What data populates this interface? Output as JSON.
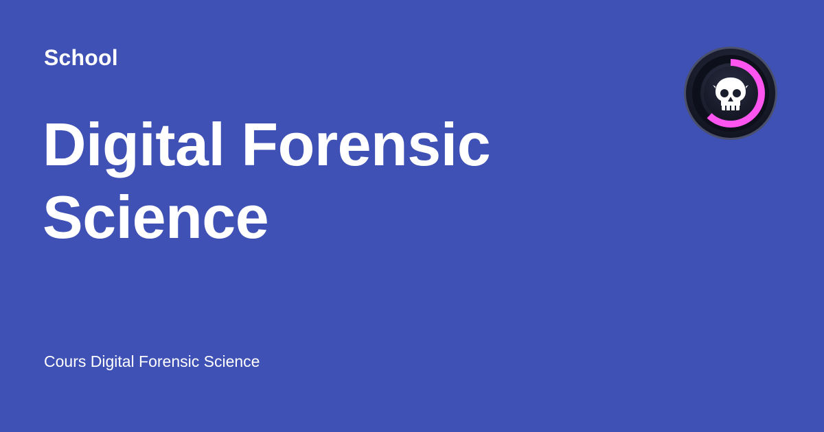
{
  "card": {
    "eyebrow": "School",
    "title": "Digital Forensic Science",
    "subtitle": "Cours Digital Forensic Science"
  },
  "badge": {
    "icon": "skull-icon",
    "progress": 0.62
  },
  "colors": {
    "background": "#3f51b5",
    "text": "#ffffff",
    "badge_ring": "#ff55f0",
    "badge_body": "#1c1f2e"
  }
}
